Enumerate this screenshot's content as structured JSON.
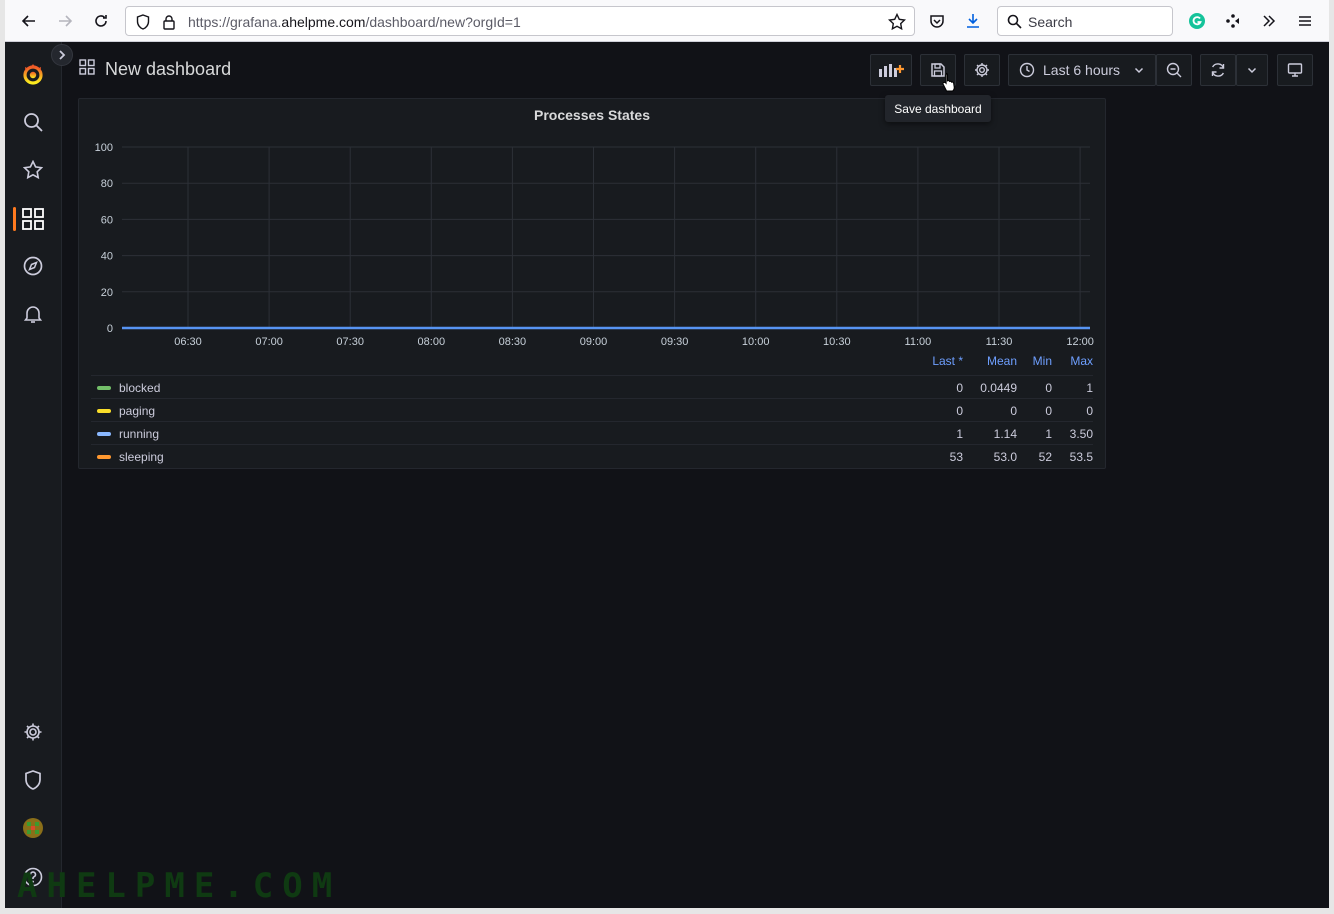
{
  "browser": {
    "url_prefix": "https://grafana.",
    "url_domain": "ahelpme.com",
    "url_suffix": "/dashboard/new?orgId=1",
    "search_placeholder": "Search"
  },
  "dashboard": {
    "title": "New dashboard",
    "time_range": "Last 6 hours",
    "tooltip": "Save dashboard"
  },
  "panel": {
    "title": "Processes States",
    "legend_headers": {
      "last": "Last *",
      "mean": "Mean",
      "min": "Min",
      "max": "Max"
    },
    "legend_rows": [
      {
        "name": "blocked",
        "color": "#73bf69",
        "last": "0",
        "mean": "0.0449",
        "min": "0",
        "max": "1"
      },
      {
        "name": "paging",
        "color": "#fade2a",
        "last": "0",
        "mean": "0",
        "min": "0",
        "max": "0"
      },
      {
        "name": "running",
        "color": "#8ab8ff",
        "last": "1",
        "mean": "1.14",
        "min": "1",
        "max": "3.50"
      },
      {
        "name": "sleeping",
        "color": "#ff9830",
        "last": "53",
        "mean": "53.0",
        "min": "52",
        "max": "53.5"
      }
    ]
  },
  "chart_data": {
    "type": "line",
    "title": "Processes States",
    "y_ticks": [
      "0",
      "20",
      "40",
      "60",
      "80",
      "100"
    ],
    "ylim": [
      0,
      100
    ],
    "x_ticks": [
      "06:30",
      "07:00",
      "07:30",
      "08:00",
      "08:30",
      "09:00",
      "09:30",
      "10:00",
      "10:30",
      "11:00",
      "11:30",
      "12:00"
    ],
    "grid": true,
    "series_line_color": "#5794f2",
    "series_line_value": 0
  },
  "watermark": "AHELPME.COM",
  "colors": {
    "accent": "#ff7a1f",
    "background": "#111217",
    "panel": "#181b1f"
  }
}
